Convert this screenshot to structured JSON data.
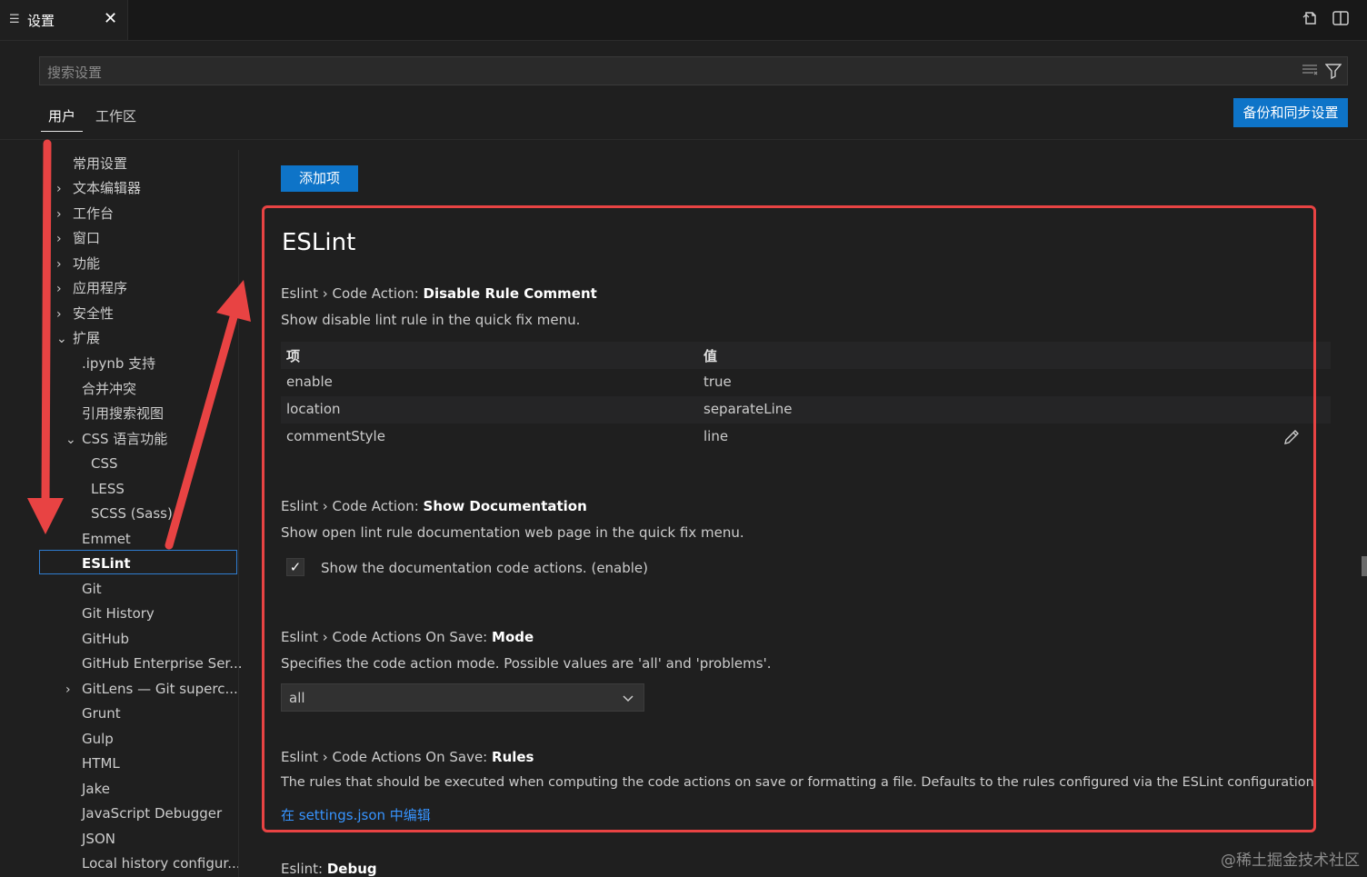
{
  "tab": {
    "icon": "settings-list-icon",
    "title": "设置",
    "close": "✕"
  },
  "top_icons": {
    "open_json": "open-settings-json-icon",
    "split": "split-editor-icon"
  },
  "search": {
    "placeholder": "搜索设置",
    "clear_filter_icon": "clear-filter-icon",
    "filter_icon": "filter-icon"
  },
  "scopes": [
    {
      "label": "用户",
      "active": true
    },
    {
      "label": "工作区",
      "active": false
    }
  ],
  "sync_button": "备份和同步设置",
  "toc": [
    {
      "label": "常用设置",
      "chevron": ""
    },
    {
      "label": "文本编辑器",
      "chevron": "›"
    },
    {
      "label": "工作台",
      "chevron": "›"
    },
    {
      "label": "窗口",
      "chevron": "›"
    },
    {
      "label": "功能",
      "chevron": "›"
    },
    {
      "label": "应用程序",
      "chevron": "›"
    },
    {
      "label": "安全性",
      "chevron": "›"
    },
    {
      "label": "扩展",
      "chevron": "⌄"
    },
    {
      "label": ".ipynb 支持",
      "chevron": ""
    },
    {
      "label": "合并冲突",
      "chevron": ""
    },
    {
      "label": "引用搜索视图",
      "chevron": ""
    },
    {
      "label": "CSS 语言功能",
      "chevron": "⌄"
    },
    {
      "label": "CSS",
      "chevron": ""
    },
    {
      "label": "LESS",
      "chevron": ""
    },
    {
      "label": "SCSS (Sass)",
      "chevron": ""
    },
    {
      "label": "Emmet",
      "chevron": ""
    },
    {
      "label": "ESLint",
      "chevron": "",
      "selected": true
    },
    {
      "label": "Git",
      "chevron": ""
    },
    {
      "label": "Git History",
      "chevron": ""
    },
    {
      "label": "GitHub",
      "chevron": ""
    },
    {
      "label": "GitHub Enterprise Ser...",
      "chevron": ""
    },
    {
      "label": "GitLens — Git superc...",
      "chevron": "›"
    },
    {
      "label": "Grunt",
      "chevron": ""
    },
    {
      "label": "Gulp",
      "chevron": ""
    },
    {
      "label": "HTML",
      "chevron": ""
    },
    {
      "label": "Jake",
      "chevron": ""
    },
    {
      "label": "JavaScript Debugger",
      "chevron": ""
    },
    {
      "label": "JSON",
      "chevron": ""
    },
    {
      "label": "Local history configur...",
      "chevron": ""
    }
  ],
  "add_item_button": "添加项",
  "section_title": "ESLint",
  "settings": {
    "disable_rule_comment": {
      "prefix": "Eslint › Code Action: ",
      "name": "Disable Rule Comment",
      "description": "Show disable lint rule in the quick fix menu.",
      "table": {
        "headers": {
          "key": "项",
          "value": "值"
        },
        "rows": [
          {
            "key": "enable",
            "value": "true"
          },
          {
            "key": "location",
            "value": "separateLine"
          },
          {
            "key": "commentStyle",
            "value": "line"
          }
        ]
      }
    },
    "show_documentation": {
      "prefix": "Eslint › Code Action: ",
      "name": "Show Documentation",
      "description": "Show open lint rule documentation web page in the quick fix menu.",
      "checkbox_label": "Show the documentation code actions. (enable)",
      "checked": true
    },
    "on_save_mode": {
      "prefix": "Eslint › Code Actions On Save: ",
      "name": "Mode",
      "description": "Specifies the code action mode. Possible values are 'all' and 'problems'.",
      "selected": "all"
    },
    "on_save_rules": {
      "prefix": "Eslint › Code Actions On Save: ",
      "name": "Rules",
      "description": "The rules that should be executed when computing the code actions on save or formatting a file. Defaults to the rules configured via the ESLint configuration",
      "link": "在 settings.json 中编辑"
    },
    "debug": {
      "prefix": "Eslint: ",
      "name": "Debug"
    }
  },
  "annotation_color": "#e84343",
  "accent_color": "#0e74c8",
  "watermark": "@稀土掘金技术社区"
}
